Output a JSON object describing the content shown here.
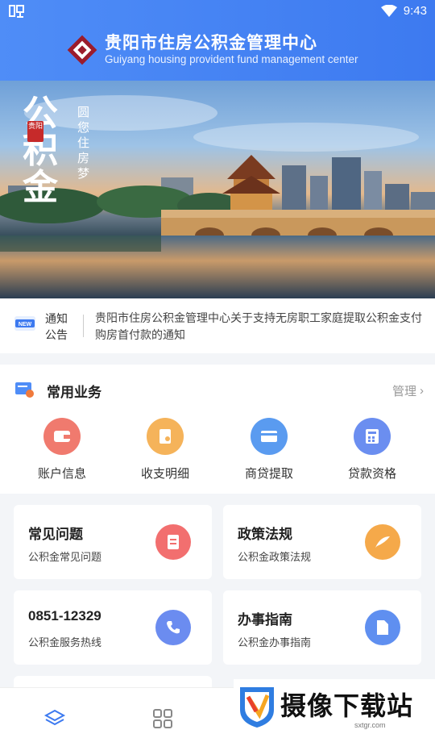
{
  "status_bar": {
    "time": "9:43",
    "app_icon": "bug-icon"
  },
  "header": {
    "title_cn": "贵阳市住房公积金管理中心",
    "title_en": "Guiyang housing provident fund management center"
  },
  "banner": {
    "calligraphy": "公积金",
    "seal": "贵阳",
    "slogan": "圆您住房梦"
  },
  "notice": {
    "label_line1": "通知",
    "label_line2": "公告",
    "text": "贵阳市住房公积金管理中心关于支持无房职工家庭提取公积金支付购房首付款的通知",
    "icon": "new-badge-icon"
  },
  "services": {
    "title": "常用业务",
    "manage": "管理",
    "items": [
      {
        "label": "账户信息",
        "icon": "wallet-icon",
        "color": "#f07a6e"
      },
      {
        "label": "收支明细",
        "icon": "receipt-icon",
        "color": "#f5b35a"
      },
      {
        "label": "商贷提取",
        "icon": "card-icon",
        "color": "#5a9bf0"
      },
      {
        "label": "贷款资格",
        "icon": "calculator-icon",
        "color": "#6b8ef0"
      }
    ]
  },
  "cards": [
    {
      "title": "常见问题",
      "subtitle": "公积金常见问题",
      "icon": "document-icon",
      "color": "#f26f6f"
    },
    {
      "title": "政策法规",
      "subtitle": "公积金政策法规",
      "icon": "quill-icon",
      "color": "#f5a94a"
    },
    {
      "title": "0851-12329",
      "subtitle": "公积金服务热线",
      "icon": "phone-icon",
      "color": "#6b8cf0"
    },
    {
      "title": "办事指南",
      "subtitle": "公积金办事指南",
      "icon": "file-icon",
      "color": "#5f8ff0"
    }
  ],
  "bottom_nav": [
    {
      "icon": "layers-icon"
    },
    {
      "icon": "grid-icon"
    }
  ],
  "watermark": {
    "text": "摄像下载站",
    "url": "sxtgr.com"
  },
  "colors": {
    "primary": "#3d7af0"
  }
}
